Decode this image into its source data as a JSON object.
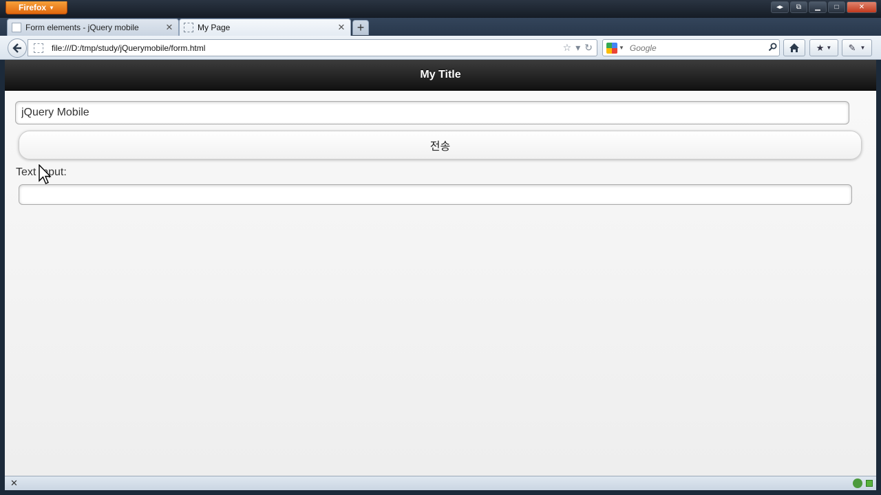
{
  "browser": {
    "menu_button": "Firefox",
    "tabs": [
      {
        "label": "Form elements - jQuery mobile",
        "active": false
      },
      {
        "label": "My Page",
        "active": true
      }
    ],
    "new_tab_label": "+",
    "url": "file:///D:/tmp/study/jQuerymobile/form.html",
    "search": {
      "placeholder": "Google"
    }
  },
  "page": {
    "header_title": "My Title",
    "text_input_value": "jQuery Mobile",
    "submit_label": "전송",
    "output_label": "Text Input:",
    "output_value": ""
  },
  "colors": {
    "header_bg": "#1a1a1a",
    "firefox_button": "#e8771e",
    "page_bg": "#f4f4f4"
  },
  "icons": {
    "back": "back-arrow-icon",
    "reload": "reload-icon",
    "bookmark_star": "star-icon",
    "home": "home-icon",
    "search": "magnifier-icon"
  }
}
